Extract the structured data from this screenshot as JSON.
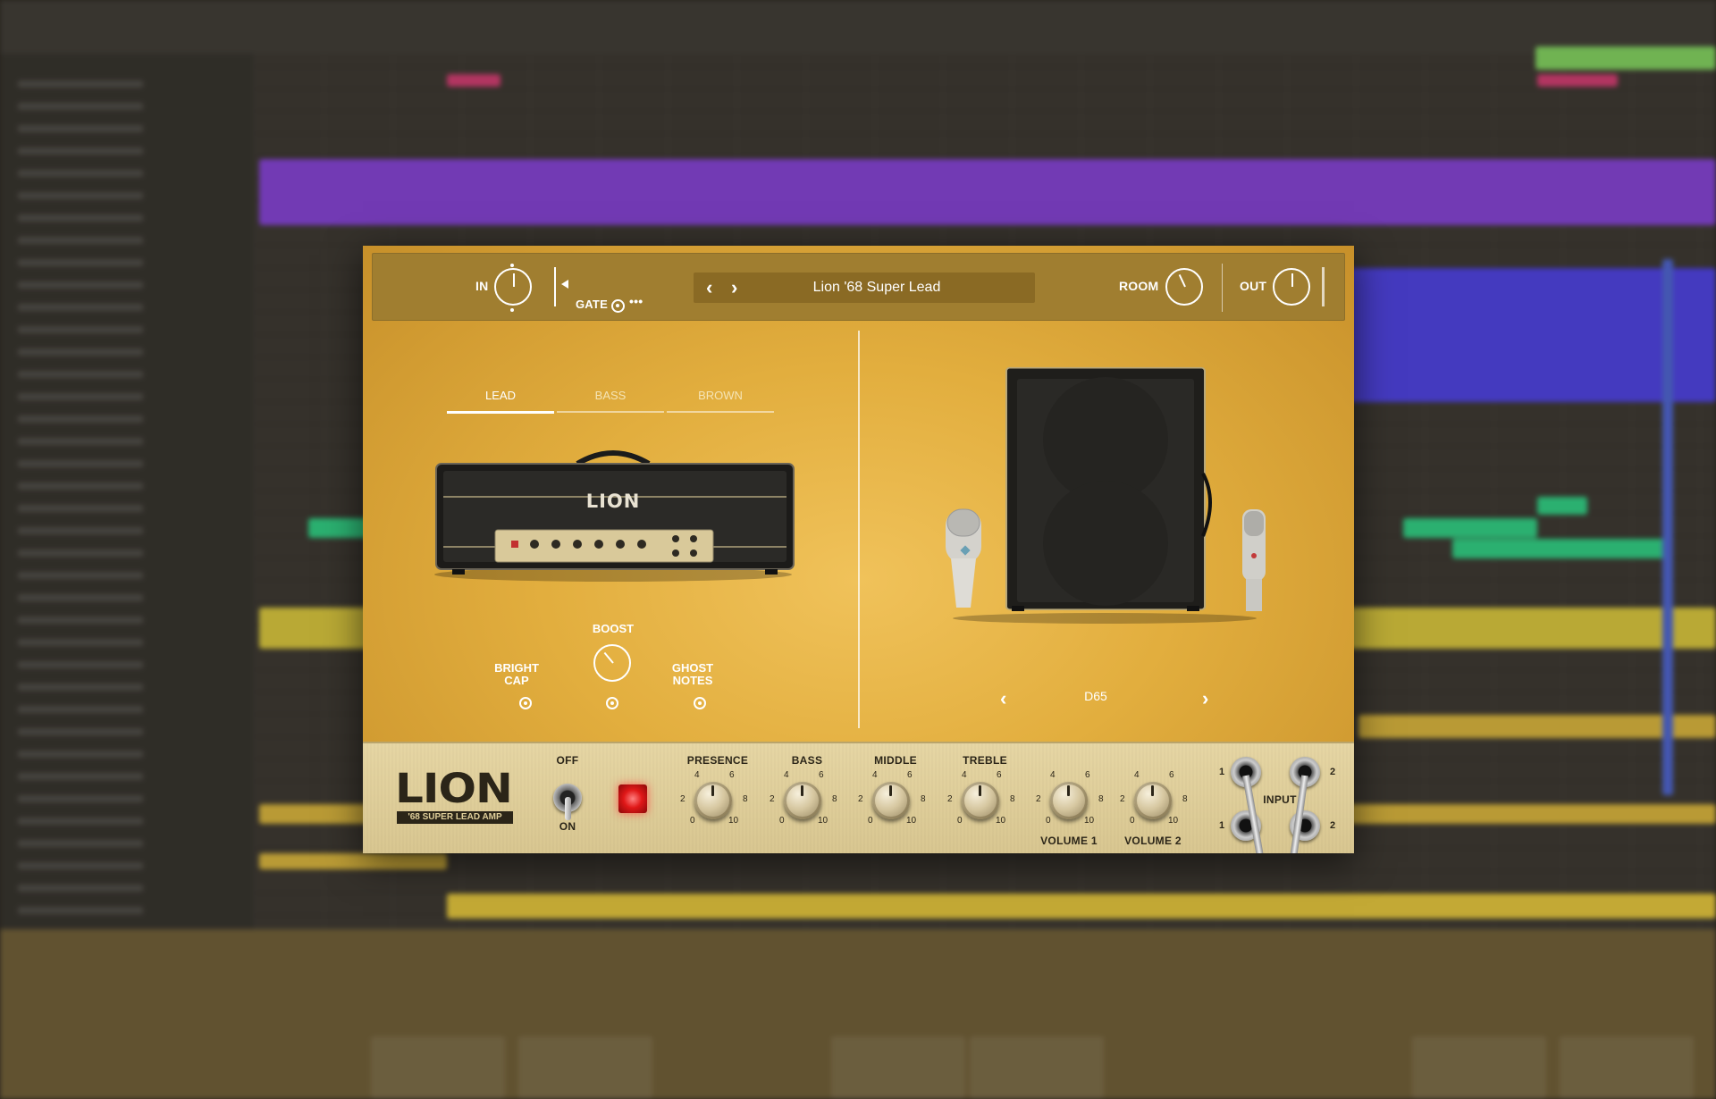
{
  "plugin": {
    "header": {
      "in_label": "IN",
      "gate_label": "GATE",
      "more_icon": "•••",
      "preset_name": "Lion '68 Super Lead",
      "prev_icon": "‹",
      "next_icon": "›",
      "room_label": "ROOM",
      "out_label": "OUT"
    },
    "amp": {
      "tabs": [
        {
          "label": "LEAD",
          "active": true
        },
        {
          "label": "BASS",
          "active": false
        },
        {
          "label": "BROWN",
          "active": false
        }
      ],
      "logo": "LION",
      "options": {
        "bright_cap": "BRIGHT\nCAP",
        "boost": "BOOST",
        "ghost_notes": "GHOST\nNOTES"
      }
    },
    "cabinet": {
      "name": "D65",
      "prev_icon": "‹",
      "next_icon": "›"
    },
    "panel": {
      "brand": "LION",
      "model": "'68 SUPER LEAD AMP",
      "switch_off": "OFF",
      "switch_on": "ON",
      "knobs": [
        {
          "label": "PRESENCE",
          "bottom_label": ""
        },
        {
          "label": "BASS",
          "bottom_label": ""
        },
        {
          "label": "MIDDLE",
          "bottom_label": ""
        },
        {
          "label": "TREBLE",
          "bottom_label": ""
        },
        {
          "label": "",
          "bottom_label": "VOLUME 1"
        },
        {
          "label": "",
          "bottom_label": "VOLUME 2"
        }
      ],
      "scale": {
        "s0": "0",
        "s2": "2",
        "s4": "4",
        "s6": "6",
        "s8": "8",
        "s10": "10"
      },
      "input_label": "INPUT",
      "jack_1": "1",
      "jack_2": "2"
    }
  },
  "colors": {
    "plugin_bg": "#e2ae3e",
    "header_bg": "#a07e30",
    "panel_bg": "#e0cf9a",
    "daw_purple": "#7c3fc4",
    "daw_blue": "#4a3fd0",
    "daw_green": "#2fbf7a",
    "daw_yellow": "#c9b83a"
  }
}
